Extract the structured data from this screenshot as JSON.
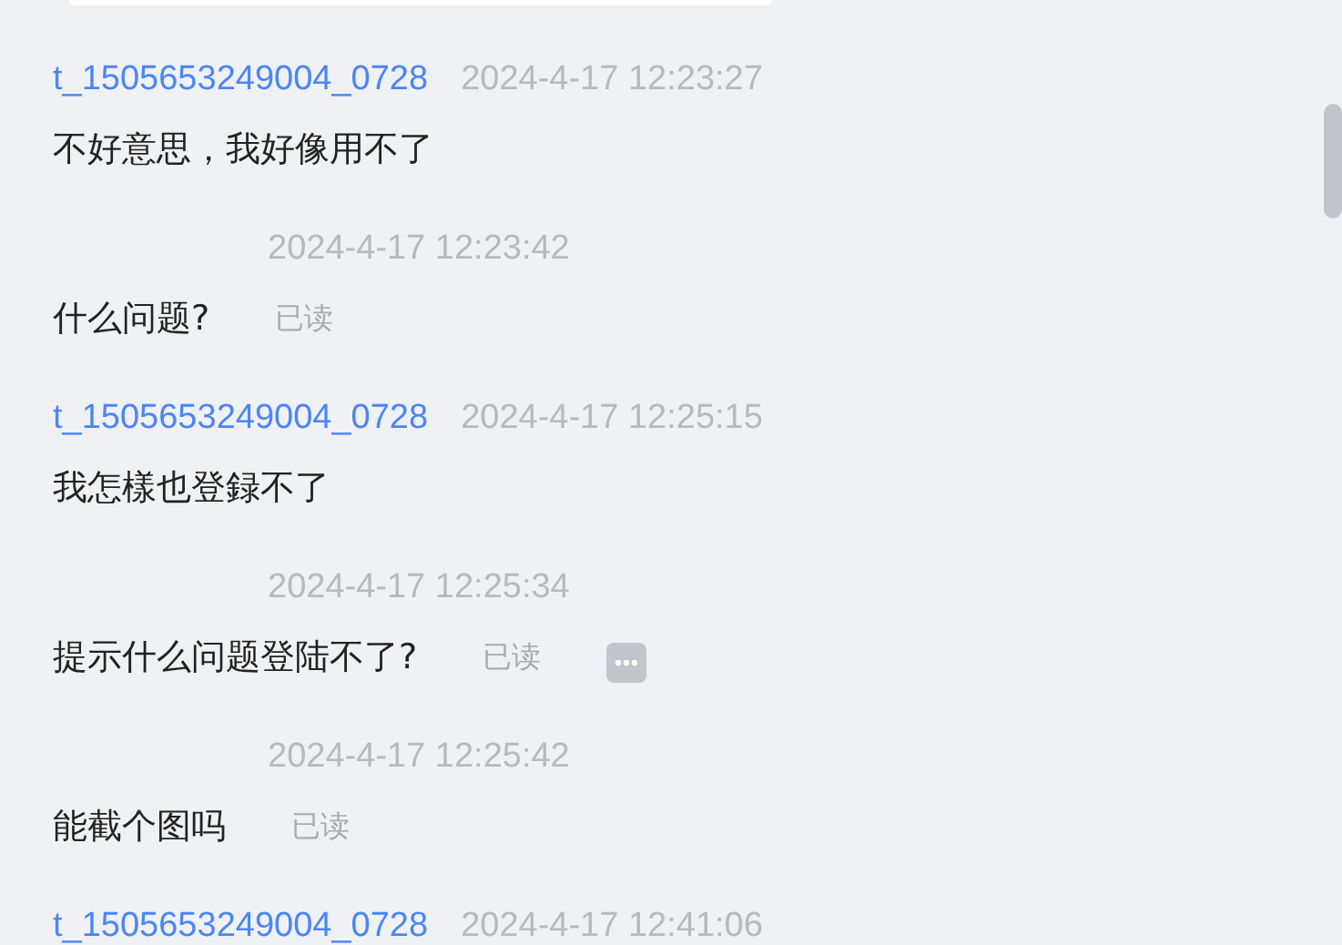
{
  "messages": [
    {
      "kind": "customer",
      "sender": "t_1505653249004_0728",
      "time": "2024-4-17 12:23:27",
      "text": "不好意思，我好像用不了"
    },
    {
      "kind": "agent",
      "time": "2024-4-17 12:23:42",
      "text": "什么问题?",
      "status": "已读",
      "more": false
    },
    {
      "kind": "customer",
      "sender": "t_1505653249004_0728",
      "time": "2024-4-17 12:25:15",
      "text": "我怎樣也登録不了"
    },
    {
      "kind": "agent",
      "time": "2024-4-17 12:25:34",
      "text": "提示什么问题登陆不了?",
      "status": "已读",
      "more": true
    },
    {
      "kind": "agent",
      "time": "2024-4-17 12:25:42",
      "text": "能截个图吗",
      "status": "已读",
      "more": false
    },
    {
      "kind": "customer",
      "sender": "t_1505653249004_0728",
      "time": "2024-4-17 12:41:06"
    }
  ]
}
